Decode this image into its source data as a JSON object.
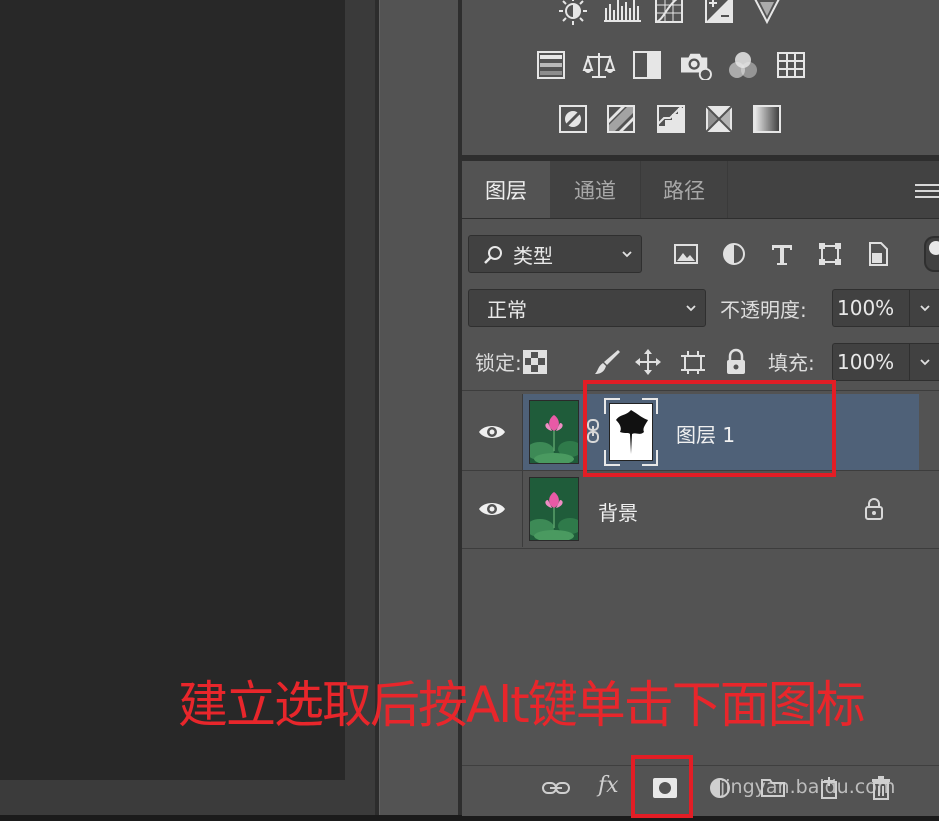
{
  "adjustments": {
    "row1": [
      "brightness-icon",
      "levels-icon",
      "curves-icon",
      "exposure-icon",
      "vibrance-icon"
    ],
    "row2": [
      "hue-saturation-icon",
      "color-balance-icon",
      "black-white-icon",
      "photo-filter-icon",
      "channel-mixer-icon",
      "color-lookup-icon"
    ],
    "row3": [
      "invert-icon",
      "posterize-icon",
      "threshold-icon",
      "selective-color-icon",
      "gradient-map-icon"
    ]
  },
  "tabs": [
    {
      "label": "图层",
      "active": true
    },
    {
      "label": "通道",
      "active": false
    },
    {
      "label": "路径",
      "active": false
    }
  ],
  "filter": {
    "kind_label": "类型"
  },
  "blend": {
    "mode": "正常",
    "opacity_label": "不透明度:",
    "opacity_value": "100%"
  },
  "lock": {
    "label": "锁定:",
    "fill_label": "填充:",
    "fill_value": "100%"
  },
  "layers": [
    {
      "name": "图层 1",
      "selected": true,
      "has_mask": true
    },
    {
      "name": "背景",
      "selected": false,
      "locked": true
    }
  ],
  "bottom_bar": {
    "fx_label": "fx"
  },
  "annotation": {
    "text": "建立选取后按Alt键单击下面图标"
  },
  "watermark": {
    "text": "jingyan.baidu.com"
  },
  "colors": {
    "annotation_red": "#e8262b",
    "selected_row": "#4f6178",
    "panel_bg": "#535353"
  }
}
